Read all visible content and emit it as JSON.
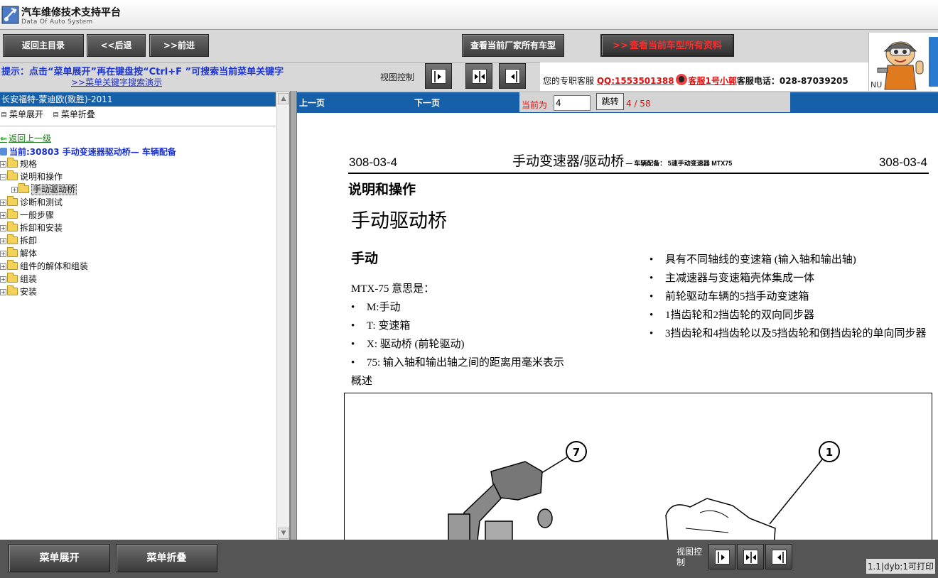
{
  "app": {
    "title": "汽车维修技术支持平台",
    "subtitle": "Data Of Auto System"
  },
  "toolbar": {
    "back_main": "返回主目录",
    "back": "<<后退",
    "forward": ">>前进",
    "all_models_maker": "查看当前厂家所有车型",
    "all_data_model": "查看当前车型所有资料",
    "all_data_model_arrow": ">>"
  },
  "hint": {
    "text": "提示：点击“菜单展开”再在键盘按“Ctrl+F ”可搜索当前菜单关键字",
    "demo_link": ">>菜单关键字搜索演示",
    "view_control": "视图控制"
  },
  "support": {
    "label": "您的专职客服",
    "qq": "QQ:1553501388",
    "agent": "客服1号小郭",
    "phone_label": "客服电话：",
    "phone": "028-87039205"
  },
  "mascot": {
    "nu_text": "NU"
  },
  "sidebar": {
    "header": "长安福特-蒙迪欧(致胜)-2011",
    "expand": "菜单展开",
    "collapse": "菜单折叠",
    "back_up": "返回上一级",
    "current": "当前:30803 手动变速器驱动桥— 车辆配备",
    "tree": [
      {
        "label": "规格",
        "indent": 0
      },
      {
        "label": "说明和操作",
        "indent": 0,
        "expanded": true
      },
      {
        "label": "手动驱动桥",
        "indent": 1,
        "selected": true
      },
      {
        "label": "诊断和测试",
        "indent": 0
      },
      {
        "label": "一般步骤",
        "indent": 0
      },
      {
        "label": "拆卸和安装",
        "indent": 0
      },
      {
        "label": "拆卸",
        "indent": 0
      },
      {
        "label": "解体",
        "indent": 0
      },
      {
        "label": "组件的解体和组装",
        "indent": 0
      },
      {
        "label": "组装",
        "indent": 0
      },
      {
        "label": "安装",
        "indent": 0
      }
    ]
  },
  "pager": {
    "prev": "上一页",
    "next": "下一页",
    "current_label": "当前为",
    "current_value": "4",
    "go": "跳转",
    "count": "4 / 58"
  },
  "document": {
    "code_left": "308-03-4",
    "code_right": "308-03-4",
    "title": "手动变速器/驱动桥",
    "title_suffix": " — 车辆配备：  5速手动变速器 MTX75",
    "section": "说明和操作",
    "heading": "手动驱动桥",
    "subheading": "手动",
    "intro": "MTX-75 意思是：",
    "left_bullets": [
      "M:手动",
      "T: 变速箱",
      "X: 驱动桥 (前轮驱动)",
      "75: 输入轴和输出轴之间的距离用毫米表示"
    ],
    "right_bullets": [
      "具有不同轴线的变速箱 (输入轴和输出轴)",
      "主减速器与变速箱壳体集成一体",
      "前轮驱动车辆的5挡手动变速箱",
      "1挡齿轮和2挡齿轮的双向同步器",
      "3挡齿轮和4挡齿轮以及5挡齿轮和倒挡齿轮的单向同步器"
    ],
    "overview": "概述",
    "callouts": [
      "7",
      "1"
    ]
  },
  "bottom": {
    "expand": "菜单展开",
    "collapse": "菜单折叠",
    "view_control": "视图控制",
    "version": "1.1|dyb:1可打印"
  }
}
